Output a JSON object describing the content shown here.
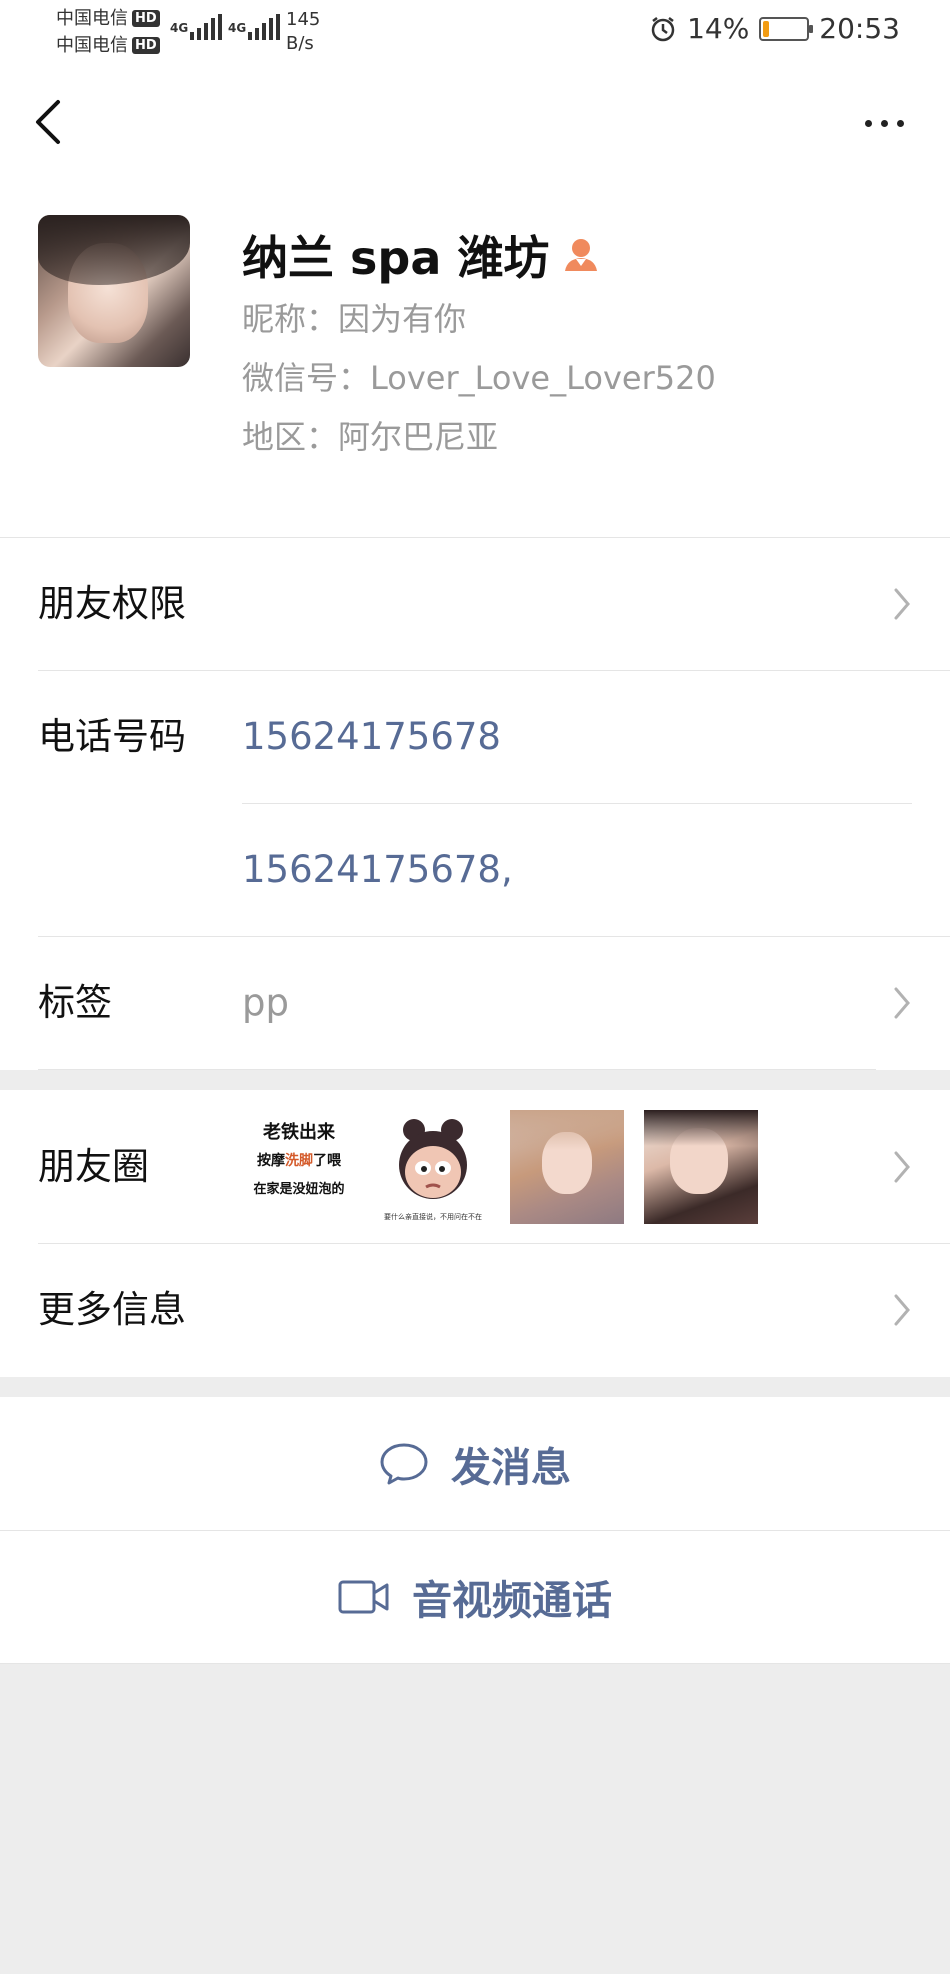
{
  "status_bar": {
    "carrier1": "中国电信",
    "carrier2": "中国电信",
    "hd": "HD",
    "net1": "4G",
    "net2": "4G",
    "speed_value": "145",
    "speed_unit": "B/s",
    "battery": "14%",
    "battery_level": 0.14,
    "time": "20:53"
  },
  "profile": {
    "name": "纳兰 spa 潍坊",
    "nickname": "昵称：因为有你",
    "wechat_id": "微信号：Lover_Love_Lover520",
    "region": "地区：阿尔巴尼亚"
  },
  "rows": {
    "friend_permissions": "朋友权限",
    "phone_label": "电话号码",
    "phone1": "15624175678",
    "phone2": "15624175678,",
    "tags_label": "标签",
    "tags_value": "pp",
    "moments_label": "朋友圈",
    "more_info": "更多信息"
  },
  "moments_thumb1": {
    "line1": "老铁出来",
    "line2_a": "按摩",
    "line2_b": "洗脚",
    "line2_c": "了喂",
    "line3": "在家是没妞泡的"
  },
  "moments_thumb2": {
    "caption": "要什么亲直接说，不用问在不在"
  },
  "actions": {
    "message": "发消息",
    "call": "音视频通话"
  },
  "colors": {
    "link": "#576b95",
    "gray_text": "#9a9a9a",
    "background": "#ededed",
    "female_icon": "#f08a5d",
    "battery": "#f39c12"
  }
}
